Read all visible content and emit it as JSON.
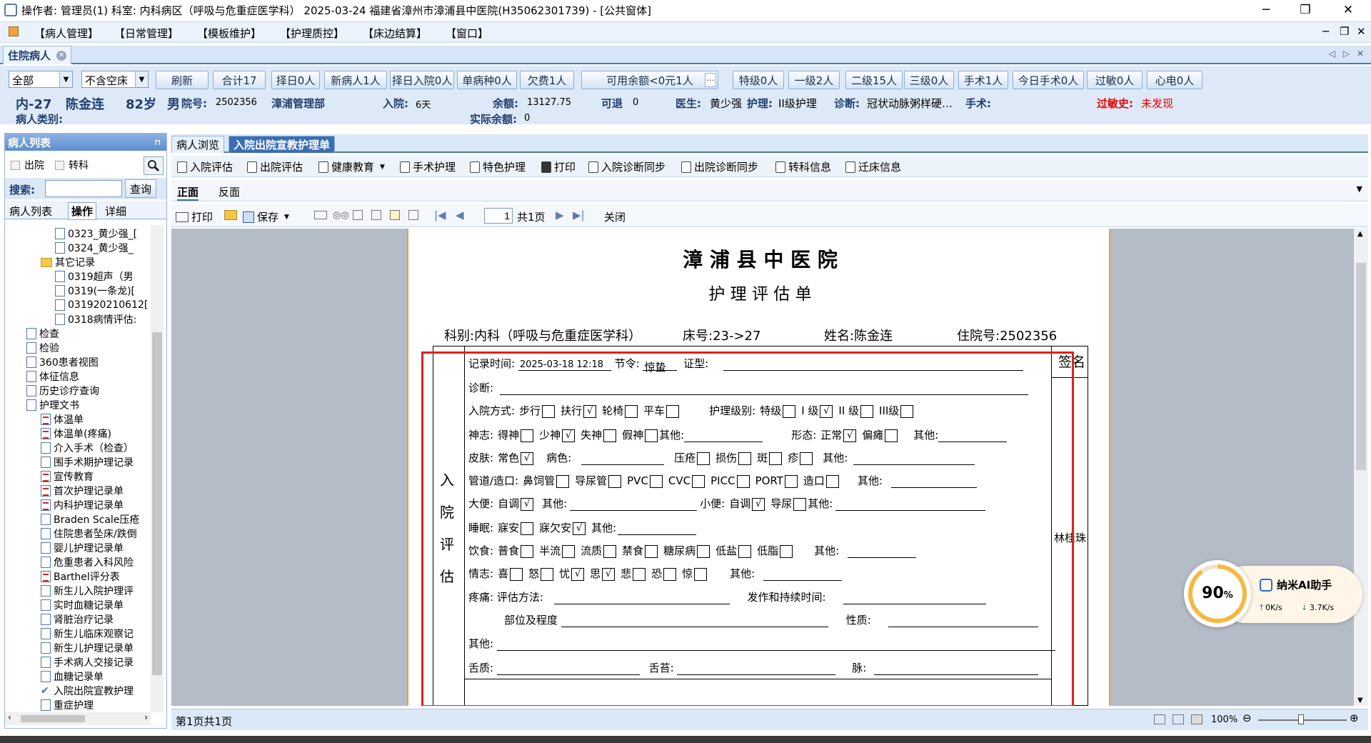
{
  "titlebar": {
    "title": "操作者: 管理员(1)  科室: 内科病区（呼吸与危重症医学科）  2025-03-24  福建省漳州市漳浦县中医院(H35062301739) - [公共窗体]"
  },
  "menu": [
    "【病人管理】",
    "【日常管理】",
    "【模板维护】",
    "【护理质控】",
    "【床边结算】",
    "【窗口】"
  ],
  "patient_tab": "住院病人",
  "filter": {
    "scope": "全部",
    "bed_filter": "不含空床",
    "buttons": [
      "刷新",
      "合计17",
      "择日0人",
      "新病人1人",
      "择日入院0人",
      "单病种0人",
      "欠费1人"
    ],
    "balance_label": "可用余额<0元1人",
    "level_buttons": [
      "特级0人",
      "一级2人",
      "二级15人",
      "三级0人",
      "手术1人",
      "今日手术0人",
      "过敏0人",
      "心电0人"
    ]
  },
  "patient": {
    "bed": "内-27",
    "name": "陈金连",
    "age": "82岁",
    "sex": "男",
    "inpatient_no_label": "院号:",
    "inpatient_no": "2502356",
    "insurance": "漳浦管理部",
    "admit_label": "入院:",
    "admit_days": "6天",
    "balance_label": "余额:",
    "balance": "13127.75",
    "refund_label": "可退",
    "refund": "0",
    "doctor_label": "医生:",
    "doctor": "黄少强",
    "care_label": "护理:",
    "care": "II级护理",
    "dx_label": "诊断:",
    "dx": "冠状动脉粥样硬…",
    "surgery_label": "手术:",
    "allergy_label": "过敏史:",
    "allergy": "未发现",
    "type_label": "病人类别:",
    "actual_balance_label": "实际余额:",
    "actual_balance": "0"
  },
  "left": {
    "header": "病人列表",
    "check_out": "出院",
    "check_transfer": "转科",
    "search_label": "搜索:",
    "query_btn": "查询",
    "tabs": [
      "病人列表",
      "操作",
      "详细"
    ],
    "tree": [
      {
        "t": "0323_黄少强_[",
        "lvl": 3,
        "icon": "doc"
      },
      {
        "t": "0324_黄少强_",
        "lvl": 3,
        "icon": "doc"
      },
      {
        "t": "其它记录",
        "lvl": 2,
        "icon": "folder"
      },
      {
        "t": "0319超声（男",
        "lvl": 3,
        "icon": "doc"
      },
      {
        "t": "0319(一条龙)[",
        "lvl": 3,
        "icon": "doc"
      },
      {
        "t": "031920210612[",
        "lvl": 3,
        "icon": "doc"
      },
      {
        "t": "0318病情评估:",
        "lvl": 3,
        "icon": "doc"
      },
      {
        "t": "检查",
        "lvl": 1,
        "icon": "doc"
      },
      {
        "t": "检验",
        "lvl": 1,
        "icon": "doc"
      },
      {
        "t": "360患者视图",
        "lvl": 1,
        "icon": "doc"
      },
      {
        "t": "体征信息",
        "lvl": 1,
        "icon": "doc"
      },
      {
        "t": "历史诊疗查询",
        "lvl": 1,
        "icon": "doc"
      },
      {
        "t": "护理文书",
        "lvl": 1,
        "icon": "doc"
      },
      {
        "t": "体温单",
        "lvl": 2,
        "icon": "red"
      },
      {
        "t": "体温单(疼痛)",
        "lvl": 2,
        "icon": "red"
      },
      {
        "t": "介入手术（检查）",
        "lvl": 2,
        "icon": "doc"
      },
      {
        "t": "围手术期护理记录",
        "lvl": 2,
        "icon": "doc"
      },
      {
        "t": "宣传教育",
        "lvl": 2,
        "icon": "red"
      },
      {
        "t": "首次护理记录单",
        "lvl": 2,
        "icon": "red"
      },
      {
        "t": "内科护理记录单",
        "lvl": 2,
        "icon": "red"
      },
      {
        "t": "Braden Scale压疮",
        "lvl": 2,
        "icon": "doc"
      },
      {
        "t": "住院患者坠床/跌倒",
        "lvl": 2,
        "icon": "doc"
      },
      {
        "t": "婴儿护理记录单",
        "lvl": 2,
        "icon": "doc"
      },
      {
        "t": "危重患者入科风险",
        "lvl": 2,
        "icon": "doc"
      },
      {
        "t": "Barthel评分表",
        "lvl": 2,
        "icon": "red"
      },
      {
        "t": "新生儿入院护理评",
        "lvl": 2,
        "icon": "doc"
      },
      {
        "t": "实时血糖记录单",
        "lvl": 2,
        "icon": "doc"
      },
      {
        "t": "肾脏治疗记录",
        "lvl": 2,
        "icon": "doc"
      },
      {
        "t": "新生儿临床观察记",
        "lvl": 2,
        "icon": "doc"
      },
      {
        "t": "新生儿护理记录单",
        "lvl": 2,
        "icon": "doc"
      },
      {
        "t": "手术病人交接记录",
        "lvl": 2,
        "icon": "doc"
      },
      {
        "t": "血糖记录单",
        "lvl": 2,
        "icon": "doc"
      },
      {
        "t": "入院出院宣教护理",
        "lvl": 2,
        "icon": "check"
      },
      {
        "t": "重症护理",
        "lvl": 2,
        "icon": "doc"
      }
    ]
  },
  "right_tabs": [
    "病人浏览",
    "入院出院宣教护理单"
  ],
  "toolbar1": [
    "入院评估",
    "出院评估",
    "健康教育",
    "手术护理",
    "特色护理",
    "打印",
    "入院诊断同步",
    "出院诊断同步",
    "转科信息",
    "迁床信息"
  ],
  "toolbar2": [
    "正面",
    "反面"
  ],
  "toolbar3": {
    "print": "打印",
    "save": "保存",
    "page": "1",
    "total": "共1页",
    "close": "关闭"
  },
  "form": {
    "hospital": "漳 浦 县 中 医 院",
    "title": "护 理 评 估 单",
    "dept": "科别:内科（呼吸与危重症医学科）",
    "bed": "床号:23->27",
    "name": "姓名:陈金连",
    "no": "住院号:2502356",
    "side_label": [
      "入",
      "院",
      "评",
      "估"
    ],
    "sign_label": "签名",
    "signer": "林桂珠",
    "record_time_label": "记录时间:",
    "record_time": "2025-03-18 12:18",
    "season_label": "节令:",
    "season": "惊蛰",
    "syndrome_label": "证型:",
    "diagnosis_label": "诊断:",
    "admit_mode_label": "入院方式:",
    "admit_modes": [
      [
        "步行",
        ""
      ],
      [
        "扶行",
        "√"
      ],
      [
        "轮椅",
        ""
      ],
      [
        "平车",
        ""
      ]
    ],
    "care_level_label": "护理级别:",
    "care_levels": [
      [
        "特级",
        ""
      ],
      [
        "I 级",
        "√"
      ],
      [
        "II 级",
        ""
      ],
      [
        "III级",
        ""
      ]
    ],
    "mind_label": "神志:",
    "minds": [
      [
        "得神",
        ""
      ],
      [
        "少神",
        "√"
      ],
      [
        "失神",
        ""
      ],
      [
        "假神",
        ""
      ]
    ],
    "other": "其他:",
    "shape_label": "形态:",
    "shapes": [
      [
        "正常",
        "√"
      ],
      [
        "偏瘫",
        ""
      ]
    ],
    "skin_label": "皮肤:",
    "skin_normal": [
      "常色",
      "√"
    ],
    "skin_color_label": "病色:",
    "skin_items": [
      [
        "压疮",
        ""
      ],
      [
        "损伤",
        ""
      ],
      [
        "斑",
        ""
      ],
      [
        "疹",
        ""
      ]
    ],
    "tube_label": "管道/造口:",
    "tubes": [
      [
        "鼻饲管",
        ""
      ],
      [
        "导尿管",
        ""
      ],
      [
        "PVC",
        ""
      ],
      [
        "CVC",
        ""
      ],
      [
        "PICC",
        ""
      ],
      [
        "PORT",
        ""
      ],
      [
        "造口",
        ""
      ]
    ],
    "stool_label": "大便:",
    "stool": [
      "自调",
      "√"
    ],
    "urine_label": "小便:",
    "urine": [
      [
        "自调",
        "√"
      ],
      [
        "导尿",
        ""
      ]
    ],
    "sleep_label": "睡眠:",
    "sleeps": [
      [
        "寐安",
        ""
      ],
      [
        "寐欠安",
        "√"
      ]
    ],
    "diet_label": "饮食:",
    "diets": [
      [
        "普食",
        ""
      ],
      [
        "半流",
        ""
      ],
      [
        "流质",
        ""
      ],
      [
        "禁食",
        ""
      ],
      [
        "糖尿病",
        ""
      ],
      [
        "低盐",
        ""
      ],
      [
        "低脂",
        ""
      ]
    ],
    "emotion_label": "情志:",
    "emotions": [
      [
        "喜",
        ""
      ],
      [
        "怒",
        ""
      ],
      [
        "忧",
        "√"
      ],
      [
        "思",
        "√"
      ],
      [
        "悲",
        ""
      ],
      [
        "恐",
        ""
      ],
      [
        "惊",
        ""
      ]
    ],
    "pain_label": "疼痛:",
    "pain_method": "评估方法:",
    "pain_time": "发作和持续时间:",
    "pain_site": "部位及程度",
    "pain_nature": "性质:",
    "tongue_label": "舌质:",
    "coating_label": "舌苔:",
    "pulse_label": "脉:"
  },
  "status": {
    "text": "第1页共1页",
    "zoom": "100%"
  },
  "widget": {
    "percent": "90",
    "unit": "%",
    "name": "纳米AI助手",
    "up": "0K/s",
    "down": "3.7K/s"
  },
  "colors": {
    "accent": "#3a6eb5",
    "red_box": "#e02020",
    "orange": "#f0a030"
  }
}
